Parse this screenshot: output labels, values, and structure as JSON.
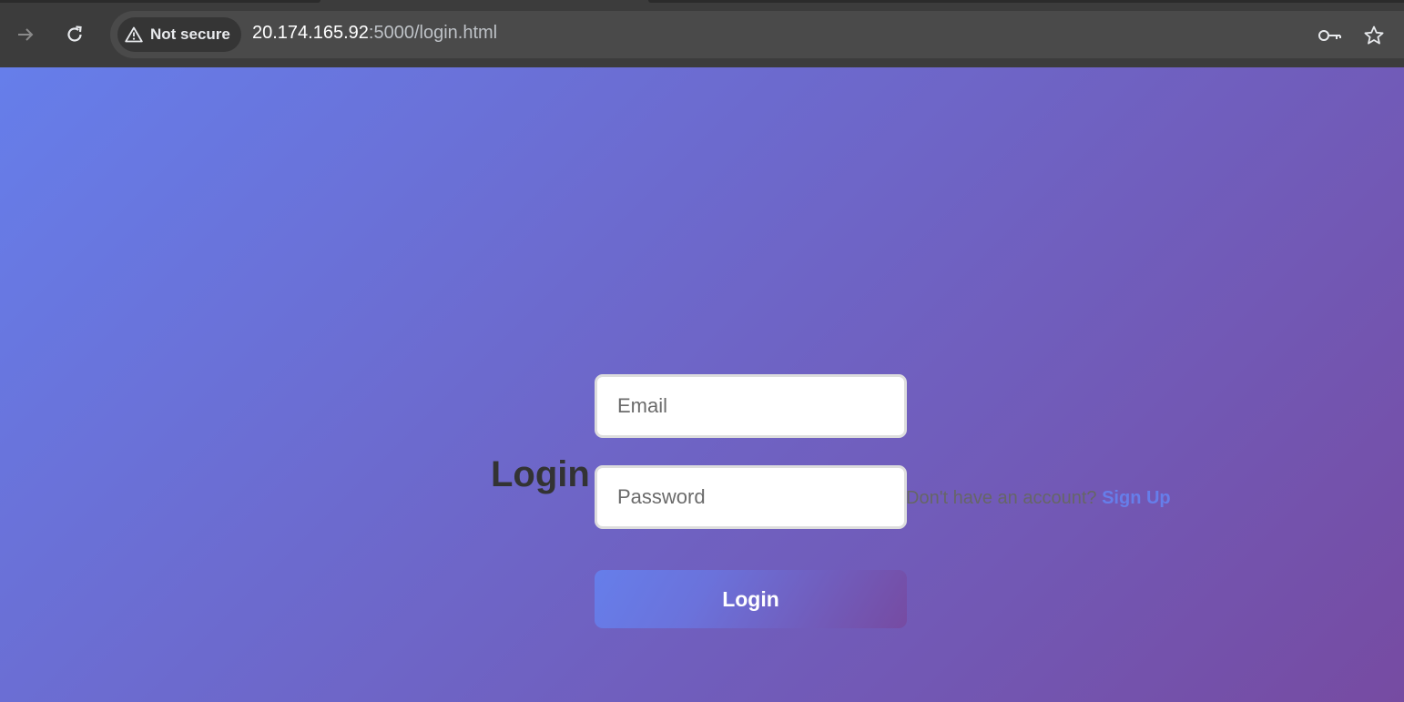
{
  "browser": {
    "security_label": "Not secure",
    "url_host": "20.174.165.92",
    "url_rest": ":5000/login.html",
    "icons": {
      "forward": "arrow-right-icon",
      "reload": "reload-icon",
      "warning": "warning-triangle-icon",
      "passwords": "key-icon",
      "bookmark": "star-icon"
    }
  },
  "page": {
    "heading": "Login",
    "email_placeholder": "Email",
    "password_placeholder": "Password",
    "submit_label": "Login",
    "signup_prompt": "Don't have an account? ",
    "signup_link": "Sign Up"
  },
  "colors": {
    "gradient_start": "#667eea",
    "gradient_end": "#764ba2",
    "heading": "#333333",
    "link": "#667eea"
  }
}
